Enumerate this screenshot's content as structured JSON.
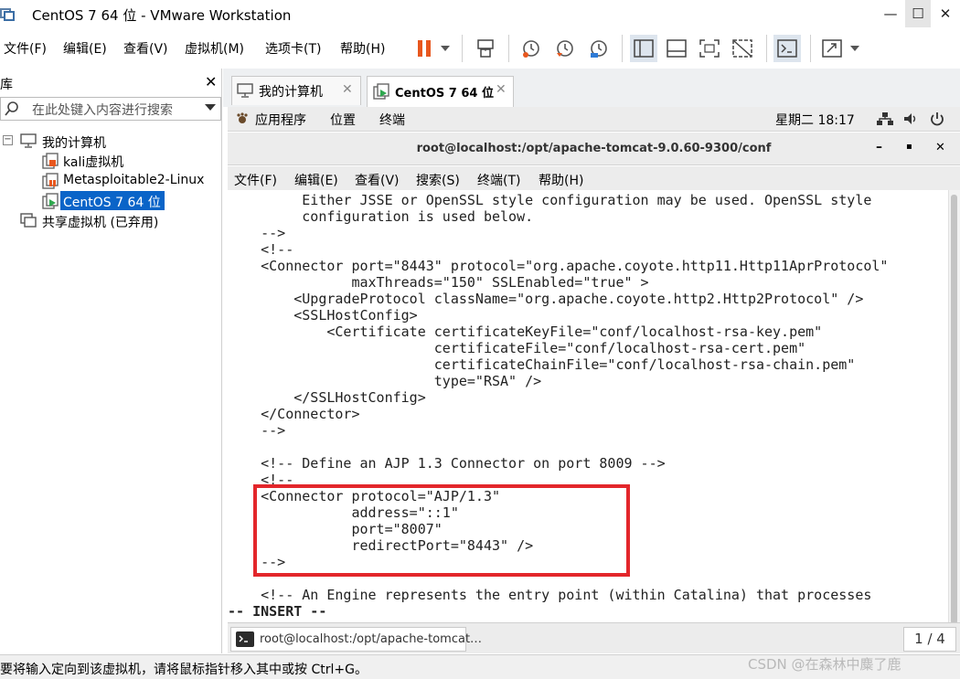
{
  "window": {
    "title": "CentOS 7 64 位 - VMware Workstation",
    "minimize_glyph": "—",
    "maximize_glyph": "☐",
    "close_glyph": "✕"
  },
  "menu": {
    "file": "文件(F)",
    "edit": "编辑(E)",
    "view": "查看(V)",
    "vm": "虚拟机(M)",
    "tabs": "选项卡(T)",
    "help": "帮助(H)"
  },
  "toolbar_icons": [
    "pause-icon",
    "dropdown-icon",
    "send-keys-icon",
    "snapshot-icon",
    "revert-snapshot-icon",
    "snapshot-manager-icon",
    "library-view-icon",
    "thumbnail-view-icon",
    "fullscreen-icon",
    "unity-icon",
    "console-icon",
    "stretch-icon",
    "dropdown-icon"
  ],
  "library": {
    "title": "库",
    "close_glyph": "✕",
    "search_placeholder": "在此处键入内容进行搜索",
    "tree": {
      "root": "我的计算机",
      "expand_glyph": "−",
      "items": [
        "kali虚拟机",
        "Metasploitable2-Linux",
        "CentOS 7 64 位"
      ],
      "shared": "共享虚拟机 (已弃用)"
    }
  },
  "tabs": [
    {
      "label": "我的计算机",
      "close": "✕"
    },
    {
      "label": "CentOS 7 64 位",
      "close": "✕"
    }
  ],
  "gnome": {
    "apps": "应用程序",
    "places": "位置",
    "terminal": "终端",
    "clock": "星期二 18:17"
  },
  "terminal": {
    "title": "root@localhost:/opt/apache-tomcat-9.0.60-9300/conf",
    "min_glyph": "–",
    "max_glyph": "▪",
    "close_glyph": "✕",
    "menu": [
      "文件(F)",
      "编辑(E)",
      "查看(V)",
      "搜索(S)",
      "终端(T)",
      "帮助(H)"
    ],
    "lines": [
      "         Either JSSE or OpenSSL style configuration may be used. OpenSSL style",
      "         configuration is used below.",
      "    -->",
      "    <!--",
      "    <Connector port=\"8443\" protocol=\"org.apache.coyote.http11.Http11AprProtocol\"",
      "               maxThreads=\"150\" SSLEnabled=\"true\" >",
      "        <UpgradeProtocol className=\"org.apache.coyote.http2.Http2Protocol\" />",
      "        <SSLHostConfig>",
      "            <Certificate certificateKeyFile=\"conf/localhost-rsa-key.pem\"",
      "                         certificateFile=\"conf/localhost-rsa-cert.pem\"",
      "                         certificateChainFile=\"conf/localhost-rsa-chain.pem\"",
      "                         type=\"RSA\" />",
      "        </SSLHostConfig>",
      "    </Connector>",
      "    -->",
      "",
      "    <!-- Define an AJP 1.3 Connector on port 8009 -->",
      "    <!--",
      "    <Connector protocol=\"AJP/1.3\"",
      "               address=\"::1\"",
      "               port=\"8007\"",
      "               redirectPort=\"8443\" />",
      "    -->",
      "",
      "    <!-- An Engine represents the entry point (within Catalina) that processes",
      "-- INSERT --"
    ]
  },
  "taskbar": {
    "task_label": "root@localhost:/opt/apache-tomcat…",
    "page": "1 / 4"
  },
  "status": {
    "message": "要将输入定向到该虚拟机，请将鼠标指针移入其中或按 Ctrl+G。",
    "watermark": "CSDN @在森林中麋了鹿"
  },
  "colors": {
    "selection": "#0a64c8",
    "highlight_box": "#e3262b",
    "pause": "#e8571e"
  }
}
